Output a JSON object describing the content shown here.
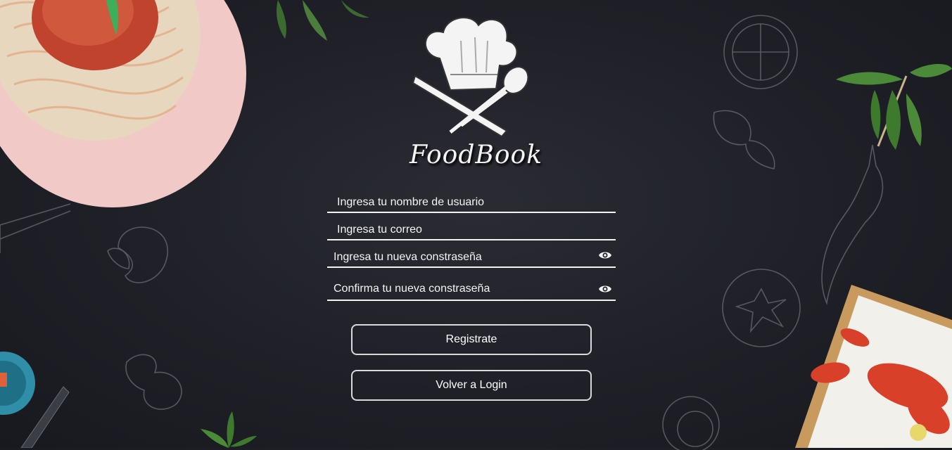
{
  "brand": {
    "name": "FoodBook"
  },
  "form": {
    "username_placeholder": "Ingresa tu nombre de usuario",
    "email_placeholder": "Ingresa tu correo",
    "password_placeholder": "Ingresa tu nueva constraseña",
    "confirm_placeholder": "Confirma tu nueva constraseña"
  },
  "actions": {
    "register_label": "Registrate",
    "back_label": "Volver a Login"
  },
  "icons": {
    "password_toggle": "eye-icon",
    "confirm_toggle": "eye-icon",
    "logo": "chef-hat-knife-spoon-icon"
  },
  "colors": {
    "background": "#1f2027",
    "text": "#ffffff",
    "underline": "#f2f2f2",
    "button_border": "#d9d9d9"
  }
}
